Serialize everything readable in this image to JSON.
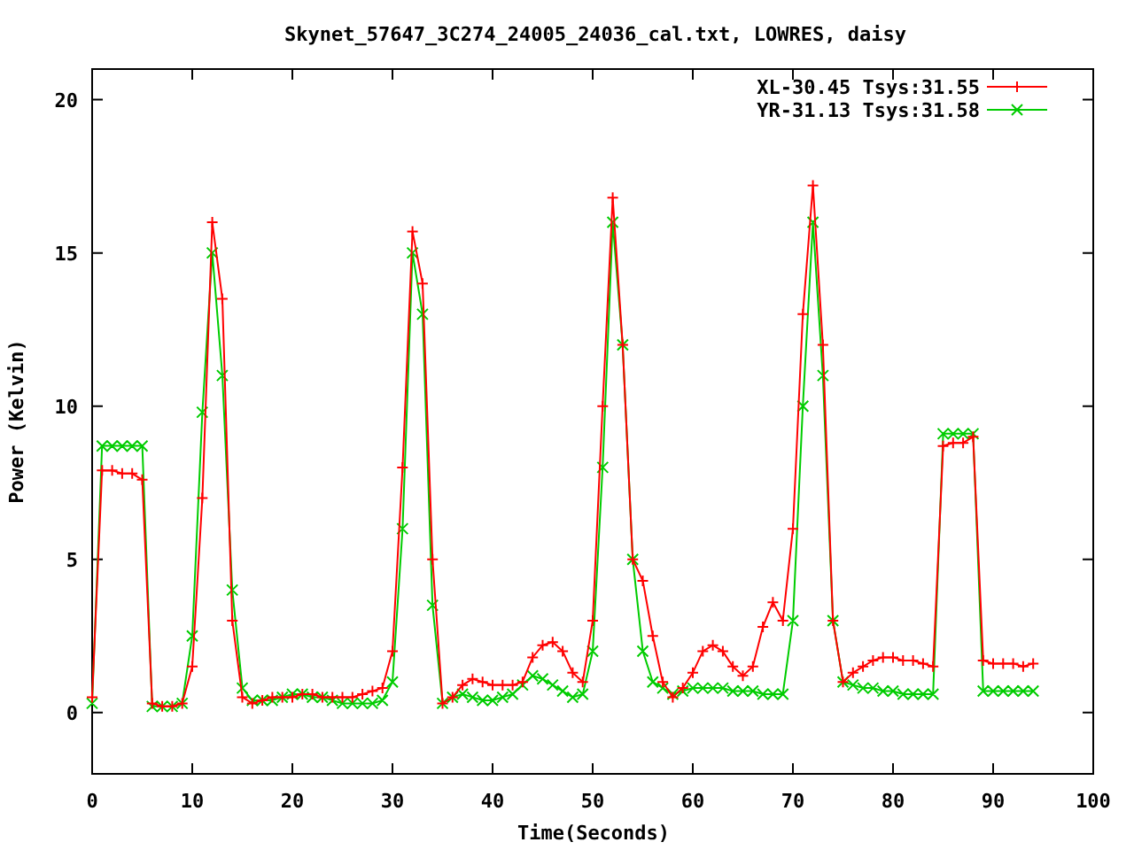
{
  "chart": {
    "chart_data": {
      "type": "line",
      "title": "Skynet_57647_3C274_24005_24036_cal.txt, LOWRES, daisy",
      "xlabel": "Time(Seconds)",
      "ylabel": "Power (Kelvin)",
      "x": [
        0,
        1,
        2,
        3,
        4,
        5,
        6,
        7,
        8,
        9,
        10,
        11,
        12,
        13,
        14,
        15,
        16,
        17,
        18,
        19,
        20,
        21,
        22,
        23,
        24,
        25,
        26,
        27,
        28,
        29,
        30,
        31,
        32,
        33,
        34,
        35,
        36,
        37,
        38,
        39,
        40,
        41,
        42,
        43,
        44,
        45,
        46,
        47,
        48,
        49,
        50,
        51,
        52,
        53,
        54,
        55,
        56,
        57,
        58,
        59,
        60,
        61,
        62,
        63,
        64,
        65,
        66,
        67,
        68,
        69,
        70,
        71,
        72,
        73,
        74,
        75,
        76,
        77,
        78,
        79,
        80,
        81,
        82,
        83,
        84,
        85,
        86,
        87,
        88,
        89,
        90,
        91,
        92,
        93,
        94
      ],
      "series": [
        {
          "name": "XL-30.45 Tsys:31.55",
          "color": "#ff0000",
          "marker": "plus",
          "values": [
            0.5,
            7.9,
            7.9,
            7.8,
            7.8,
            7.6,
            0.3,
            0.2,
            0.2,
            0.3,
            1.5,
            7,
            16,
            13.5,
            3,
            0.5,
            0.3,
            0.4,
            0.5,
            0.5,
            0.5,
            0.6,
            0.6,
            0.5,
            0.5,
            0.5,
            0.5,
            0.6,
            0.7,
            0.8,
            2,
            8,
            15.7,
            14,
            5,
            0.3,
            0.5,
            0.9,
            1.1,
            1,
            0.9,
            0.9,
            0.9,
            1,
            1.8,
            2.2,
            2.3,
            2,
            1.3,
            1,
            3,
            10,
            16.8,
            12,
            5,
            4.3,
            2.5,
            1,
            0.5,
            0.8,
            1.3,
            2,
            2.2,
            2,
            1.5,
            1.2,
            1.5,
            2.8,
            3.6,
            3,
            6,
            13,
            17.2,
            12,
            3,
            1,
            1.3,
            1.5,
            1.7,
            1.8,
            1.8,
            1.7,
            1.7,
            1.6,
            1.5,
            8.7,
            8.8,
            8.8,
            9,
            1.7,
            1.6,
            1.6,
            1.6,
            1.5,
            1.6
          ]
        },
        {
          "name": "YR-31.13 Tsys:31.58",
          "color": "#00cc00",
          "marker": "cross",
          "values": [
            0.3,
            8.7,
            8.7,
            8.7,
            8.7,
            8.7,
            0.2,
            0.2,
            0.2,
            0.3,
            2.5,
            9.8,
            15,
            11,
            4,
            0.8,
            0.4,
            0.4,
            0.4,
            0.5,
            0.6,
            0.6,
            0.5,
            0.5,
            0.4,
            0.3,
            0.3,
            0.3,
            0.3,
            0.4,
            1,
            6,
            15,
            13,
            3.5,
            0.3,
            0.5,
            0.6,
            0.5,
            0.4,
            0.4,
            0.5,
            0.6,
            0.9,
            1.2,
            1.1,
            0.9,
            0.7,
            0.5,
            0.6,
            2,
            8,
            16,
            12,
            5,
            2,
            1,
            0.8,
            0.6,
            0.7,
            0.8,
            0.8,
            0.8,
            0.8,
            0.7,
            0.7,
            0.7,
            0.6,
            0.6,
            0.6,
            3,
            10,
            16,
            11,
            3,
            1,
            0.9,
            0.8,
            0.8,
            0.7,
            0.7,
            0.6,
            0.6,
            0.6,
            0.6,
            9.1,
            9.1,
            9.1,
            9.1,
            0.7,
            0.7,
            0.7,
            0.7,
            0.7,
            0.7
          ]
        }
      ],
      "legend": "top-right",
      "xlim": [
        0,
        100
      ],
      "ylim": [
        -2,
        21
      ],
      "xticks": [
        0,
        10,
        20,
        30,
        40,
        50,
        60,
        70,
        80,
        90,
        100
      ],
      "yticks": [
        0,
        5,
        10,
        15,
        20
      ]
    }
  }
}
